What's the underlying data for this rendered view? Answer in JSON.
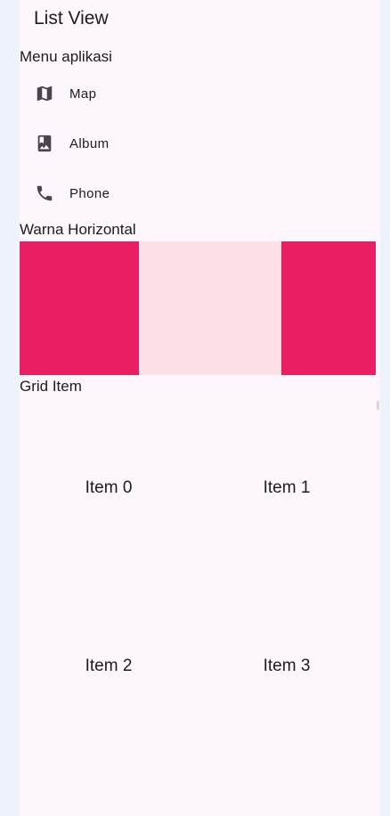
{
  "app": {
    "title": "List View"
  },
  "menu": {
    "heading": "Menu aplikasi",
    "items": [
      {
        "label": "Map",
        "icon": "map-icon"
      },
      {
        "label": "Album",
        "icon": "album-icon"
      },
      {
        "label": "Phone",
        "icon": "phone-icon"
      }
    ]
  },
  "horizontal": {
    "heading": "Warna Horizontal",
    "colors": [
      "#ea1f63",
      "#fde0e7",
      "#ea1f63"
    ]
  },
  "grid": {
    "heading": "Grid Item",
    "items": [
      "Item 0",
      "Item 1",
      "Item 2",
      "Item 3"
    ]
  }
}
